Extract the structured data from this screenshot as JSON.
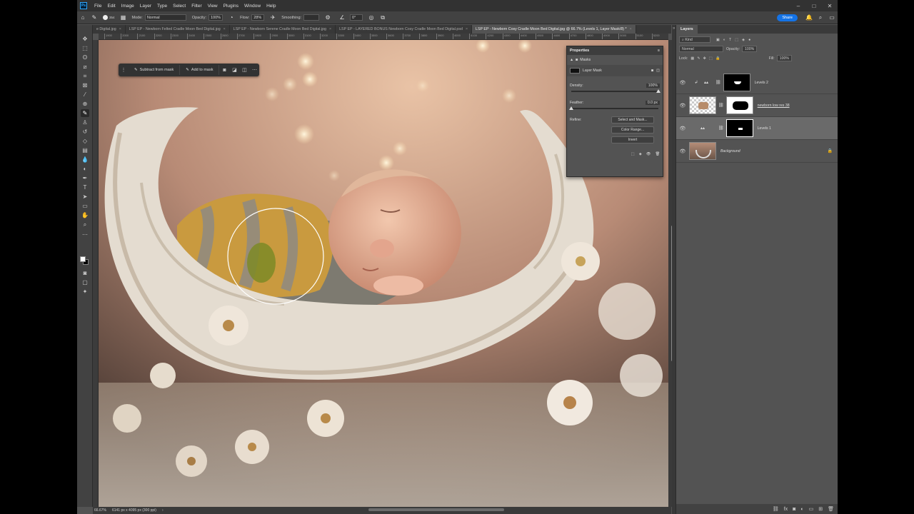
{
  "app": {
    "logo": "Ps"
  },
  "menu": [
    "File",
    "Edit",
    "Image",
    "Layer",
    "Type",
    "Select",
    "Filter",
    "View",
    "Plugins",
    "Window",
    "Help"
  ],
  "window_controls": [
    "–",
    "□",
    "✕"
  ],
  "options": {
    "mode_label": "Mode:",
    "mode_value": "Normal",
    "opacity_label": "Opacity:",
    "opacity_value": "100%",
    "flow_label": "Flow:",
    "flow_value": "28%",
    "smoothing_label": "Smoothing:",
    "smoothing_value": "",
    "angle_value": "0°",
    "brush_size": "354",
    "share_label": "Share"
  },
  "tabs": [
    {
      "label": "e Digital.jpg",
      "active": false
    },
    {
      "label": "LSP EP - Newborn Felted Cradle Moon Bed Digital.jpg",
      "active": false
    },
    {
      "label": "LSP EP - Newborn Serene Cradle Moon Bed Digital.jpg",
      "active": false
    },
    {
      "label": "LSP EP - LAYERED BONUS Newborn Cosy Cradle Moon Bed Digital.psd",
      "active": false
    },
    {
      "label": "LSP EP - Newborn Cosy Cradle Moon Bed Digital.jpg @ 66.7% (Levels 1, Layer Mask/8) *",
      "active": true
    }
  ],
  "ruler_ticks": [
    "1900",
    "2000",
    "2100",
    "2200",
    "2300",
    "2400",
    "2500",
    "2600",
    "2700",
    "2800",
    "2900",
    "3000",
    "3100",
    "3200",
    "3300",
    "3400",
    "3500",
    "3600",
    "3700",
    "3800",
    "3900",
    "4000",
    "4100",
    "4200",
    "4300",
    "4400",
    "4500",
    "4600",
    "4700",
    "4800",
    "4900",
    "5000",
    "5100",
    "5200"
  ],
  "context_bar": {
    "subtract_label": "Subtract from mask",
    "add_label": "Add to mask"
  },
  "properties": {
    "title": "Properties",
    "masks_label": "Masks",
    "layer_mask_label": "Layer Mask",
    "density_label": "Density:",
    "density_value": "100%",
    "density_fraction": 1.0,
    "feather_label": "Feather:",
    "feather_value": "0.0 px",
    "feather_fraction": 0.0,
    "refine_label": "Refine:",
    "select_and_mask": "Select and Mask...",
    "color_range": "Color Range...",
    "invert": "Invert"
  },
  "layers_panel": {
    "tab": "Layers",
    "kind_label": "Kind",
    "blend_mode": "Normal",
    "opacity_label": "Opacity:",
    "opacity_value": "100%",
    "lock_label": "Lock:",
    "fill_label": "Fill:",
    "fill_value": "100%",
    "layers": [
      {
        "name": "Levels 2",
        "selected": false
      },
      {
        "name": "newborn low res 38",
        "selected": false
      },
      {
        "name": "Levels 1",
        "selected": true
      },
      {
        "name": "Background",
        "selected": false
      }
    ]
  },
  "status": {
    "zoom": "66.67%",
    "doc_info": "6141 px x 4095 px (300 ppi)"
  },
  "colors": {
    "accent": "#1473e6",
    "panel_bg": "#535353",
    "menubar_bg": "#323232"
  }
}
